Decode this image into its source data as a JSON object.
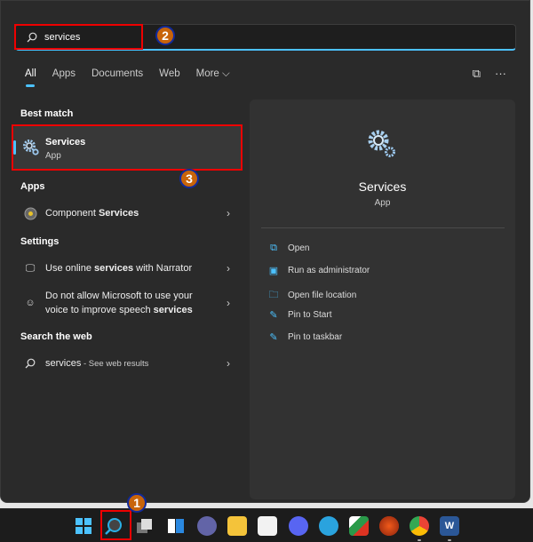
{
  "search": {
    "value": "services"
  },
  "tabs": [
    {
      "label": "All",
      "active": true
    },
    {
      "label": "Apps"
    },
    {
      "label": "Documents"
    },
    {
      "label": "Web"
    },
    {
      "label": "More ⌵"
    }
  ],
  "toolbar": {
    "share_icon": "chat-connect-icon",
    "more_label": "···"
  },
  "sections": {
    "best_match": "Best match",
    "apps": "Apps",
    "settings": "Settings",
    "web": "Search the web"
  },
  "best_match": {
    "title": "Services",
    "subtitle": "App",
    "icon": "gears-icon"
  },
  "apps": [
    {
      "parts": [
        "Component ",
        "Services"
      ],
      "icon": "component-services-icon"
    }
  ],
  "settings": [
    {
      "parts": [
        "Use online ",
        "services",
        " with Narrator"
      ],
      "icon": "narrator-icon"
    },
    {
      "line1": "Do not allow Microsoft to use your",
      "line2_parts": [
        "voice to improve speech ",
        "services"
      ],
      "icon": "speech-icon"
    }
  ],
  "web": {
    "query": "services",
    "suffix": " - See web results"
  },
  "panel": {
    "title": "Services",
    "subtitle": "App",
    "actions": [
      {
        "label": "Open",
        "icon": "open-icon"
      },
      {
        "label": "Run as administrator",
        "icon": "admin-icon"
      },
      {
        "label": "Open file location",
        "icon": "folder-icon"
      },
      {
        "label": "Pin to Start",
        "icon": "pin-icon"
      },
      {
        "label": "Pin to taskbar",
        "icon": "pin-icon"
      }
    ]
  },
  "annotations": [
    "1",
    "2",
    "3"
  ],
  "colors": {
    "accent": "#4cc2ff",
    "highlight": "#e00000",
    "badge": "#c8640a"
  },
  "taskbar": [
    "windows-start",
    "search",
    "task-view",
    "widgets",
    "teams-chat",
    "file-explorer",
    "microsoft-store",
    "discord",
    "telegram",
    "app-red-green",
    "app-flame",
    "chrome",
    "word"
  ]
}
